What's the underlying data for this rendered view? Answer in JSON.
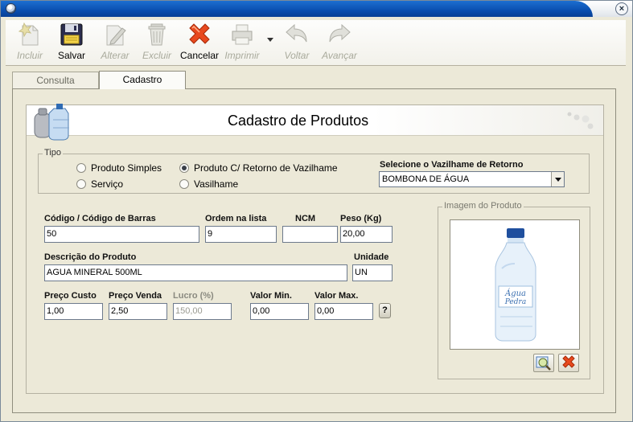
{
  "toolbar": {
    "incluir": "Incluir",
    "salvar": "Salvar",
    "alterar": "Alterar",
    "excluir": "Excluir",
    "cancelar": "Cancelar",
    "imprimir": "Imprimir",
    "voltar": "Voltar",
    "avancar": "Avançar"
  },
  "tabs": {
    "consulta": "Consulta",
    "cadastro": "Cadastro"
  },
  "header": {
    "title": "Cadastro de Produtos"
  },
  "tipo": {
    "legend": "Tipo",
    "options": {
      "produto_simples": "Produto Simples",
      "produto_retorno": "Produto C/ Retorno de Vazilhame",
      "servico": "Serviço",
      "vasilhame": "Vasilhame"
    },
    "selected": "produto_retorno",
    "vazilhame_label": "Selecione o Vazilhame de Retorno",
    "vazilhame_value": "BOMBONA DE ÁGUA"
  },
  "form": {
    "codigo_label": "Código / Código de  Barras",
    "codigo_value": "50",
    "ordem_label": "Ordem na lista",
    "ordem_value": "9",
    "ncm_label": "NCM",
    "ncm_value": "",
    "peso_label": "Peso (Kg)",
    "peso_value": "20,00",
    "descricao_label": "Descrição do Produto",
    "descricao_value": "AGUA MINERAL 500ML",
    "unidade_label": "Unidade",
    "unidade_value": "UN",
    "preco_custo_label": "Preço Custo",
    "preco_custo_value": "1,00",
    "preco_venda_label": "Preço Venda",
    "preco_venda_value": "2,50",
    "lucro_label": "Lucro (%)",
    "lucro_value": "150,00",
    "valor_min_label": "Valor Min.",
    "valor_min_value": "0,00",
    "valor_max_label": "Valor Max.",
    "valor_max_value": "0,00",
    "help_label": "?"
  },
  "imagem": {
    "legend": "Imagem do Produto",
    "bottle_text_1": "Água",
    "bottle_text_2": "Pedra"
  }
}
